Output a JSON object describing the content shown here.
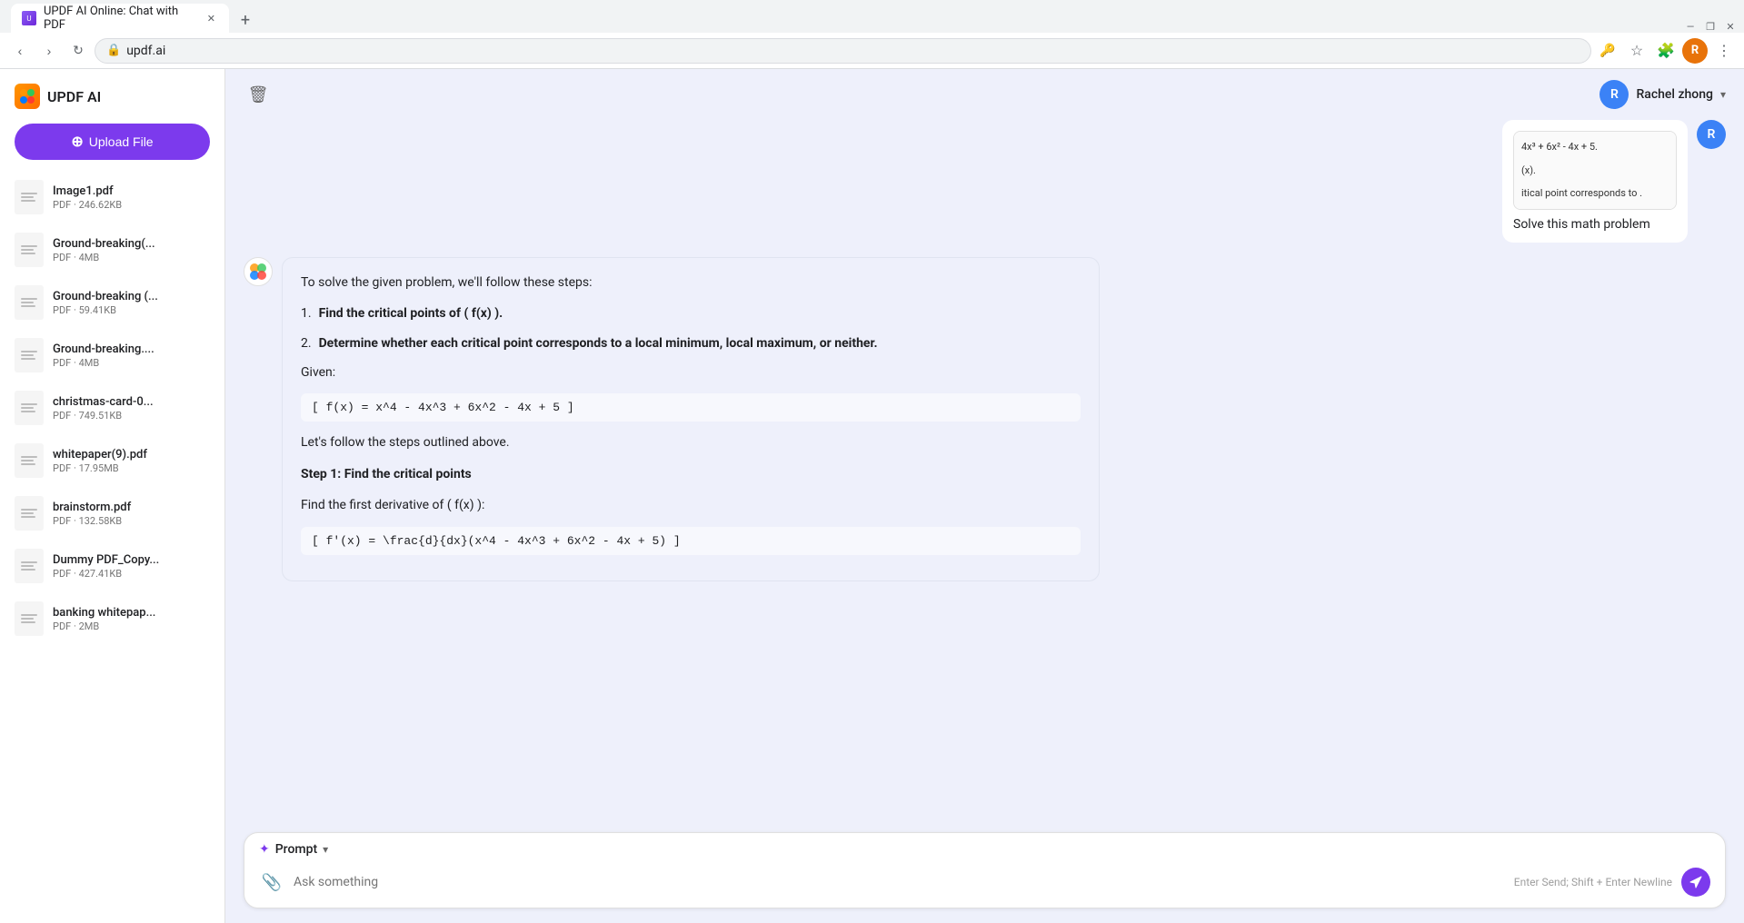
{
  "browser": {
    "tab_title": "UPDF AI Online: Chat with PDF",
    "address": "updf.ai",
    "new_tab_symbol": "+"
  },
  "sidebar": {
    "title": "UPDF AI",
    "upload_button": "Upload File",
    "files": [
      {
        "name": "Image1.pdf",
        "meta": "PDF · 246.62KB"
      },
      {
        "name": "Ground-breaking(...",
        "meta": "PDF · 4MB"
      },
      {
        "name": "Ground-breaking (...",
        "meta": "PDF · 59.41KB"
      },
      {
        "name": "Ground-breaking....",
        "meta": "PDF · 4MB"
      },
      {
        "name": "christmas-card-0...",
        "meta": "PDF · 749.51KB"
      },
      {
        "name": "whitepaper(9).pdf",
        "meta": "PDF · 17.95MB"
      },
      {
        "name": "brainstorm.pdf",
        "meta": "PDF · 132.58KB"
      },
      {
        "name": "Dummy PDF_Copy...",
        "meta": "PDF · 427.41KB"
      },
      {
        "name": "banking whitepap...",
        "meta": "PDF · 2MB"
      }
    ]
  },
  "header": {
    "user_name": "Rachel zhong",
    "user_initial": "R"
  },
  "chat": {
    "user_message": {
      "pdf_line1": "4x³ + 6x² - 4x + 5.",
      "pdf_line2": "(x).",
      "pdf_line3": "itical point corresponds to .",
      "text": "Solve this math problem"
    },
    "ai_response": {
      "intro": "To solve the given problem, we'll follow these steps:",
      "step1_label": "1.",
      "step1_text": "Find the critical points of ( f(x) ).",
      "step2_label": "2.",
      "step2_text": "Determine whether each critical point corresponds to a local minimum, local maximum, or neither.",
      "given_label": "Given:",
      "given_formula": "[ f(x) = x^4 - 4x^3 + 6x^2 - 4x + 5 ]",
      "transition": "Let's follow the steps outlined above.",
      "step1_header": "Step 1: Find the critical points",
      "step1_body": "Find the first derivative of ( f(x) ):",
      "derivative_formula": "[ f'(x) = \\frac{d}{dx}(x^4 - 4x^3 + 6x^2 - 4x + 5) ]"
    }
  },
  "input": {
    "prompt_label": "Prompt",
    "placeholder": "Ask something",
    "hint": "Enter Send; Shift + Enter Newline"
  }
}
